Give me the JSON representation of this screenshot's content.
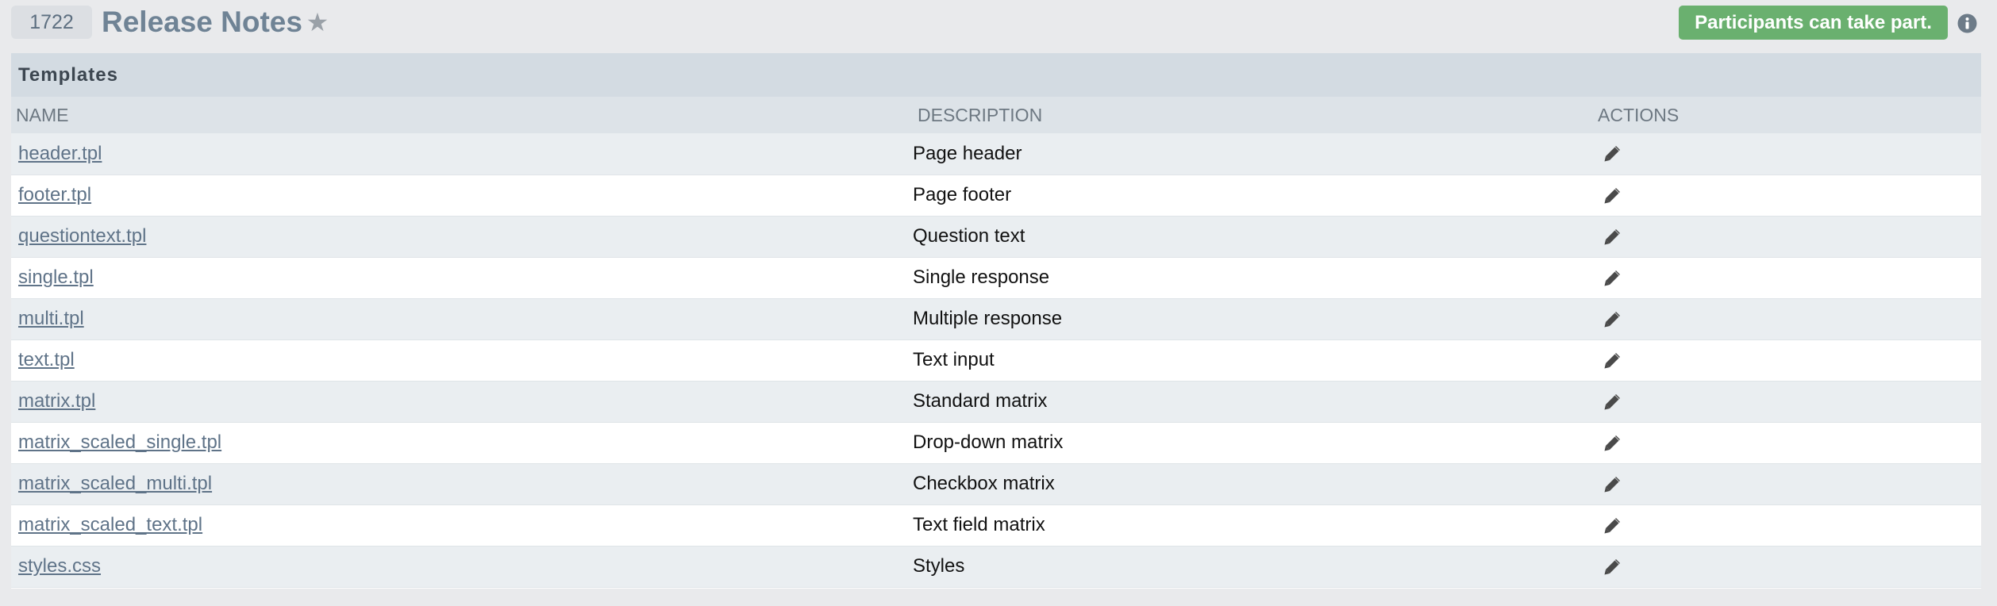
{
  "header": {
    "survey_id": "1722",
    "title": "Release Notes",
    "status_badge": "Participants can take part.",
    "icons": {
      "favorite": "star-icon",
      "info": "info-icon"
    },
    "colors": {
      "badge": "#6ab06f",
      "title": "#6f8395"
    }
  },
  "templates": {
    "section_title": "Templates",
    "columns": [
      "NAME",
      "DESCRIPTION",
      "ACTIONS"
    ],
    "rows": [
      {
        "name": "header.tpl",
        "description": "Page header",
        "action_icon": "pencil-icon"
      },
      {
        "name": "footer.tpl",
        "description": "Page footer",
        "action_icon": "pencil-icon"
      },
      {
        "name": "questiontext.tpl",
        "description": "Question text",
        "action_icon": "pencil-icon"
      },
      {
        "name": "single.tpl",
        "description": "Single response",
        "action_icon": "pencil-icon"
      },
      {
        "name": "multi.tpl",
        "description": "Multiple response",
        "action_icon": "pencil-icon"
      },
      {
        "name": "text.tpl",
        "description": "Text input",
        "action_icon": "pencil-icon"
      },
      {
        "name": "matrix.tpl",
        "description": "Standard matrix",
        "action_icon": "pencil-icon"
      },
      {
        "name": "matrix_scaled_single.tpl",
        "description": "Drop-down matrix",
        "action_icon": "pencil-icon"
      },
      {
        "name": "matrix_scaled_multi.tpl",
        "description": "Checkbox matrix",
        "action_icon": "pencil-icon"
      },
      {
        "name": "matrix_scaled_text.tpl",
        "description": "Text field matrix",
        "action_icon": "pencil-icon"
      },
      {
        "name": "styles.css",
        "description": "Styles",
        "action_icon": "pencil-icon"
      }
    ]
  }
}
